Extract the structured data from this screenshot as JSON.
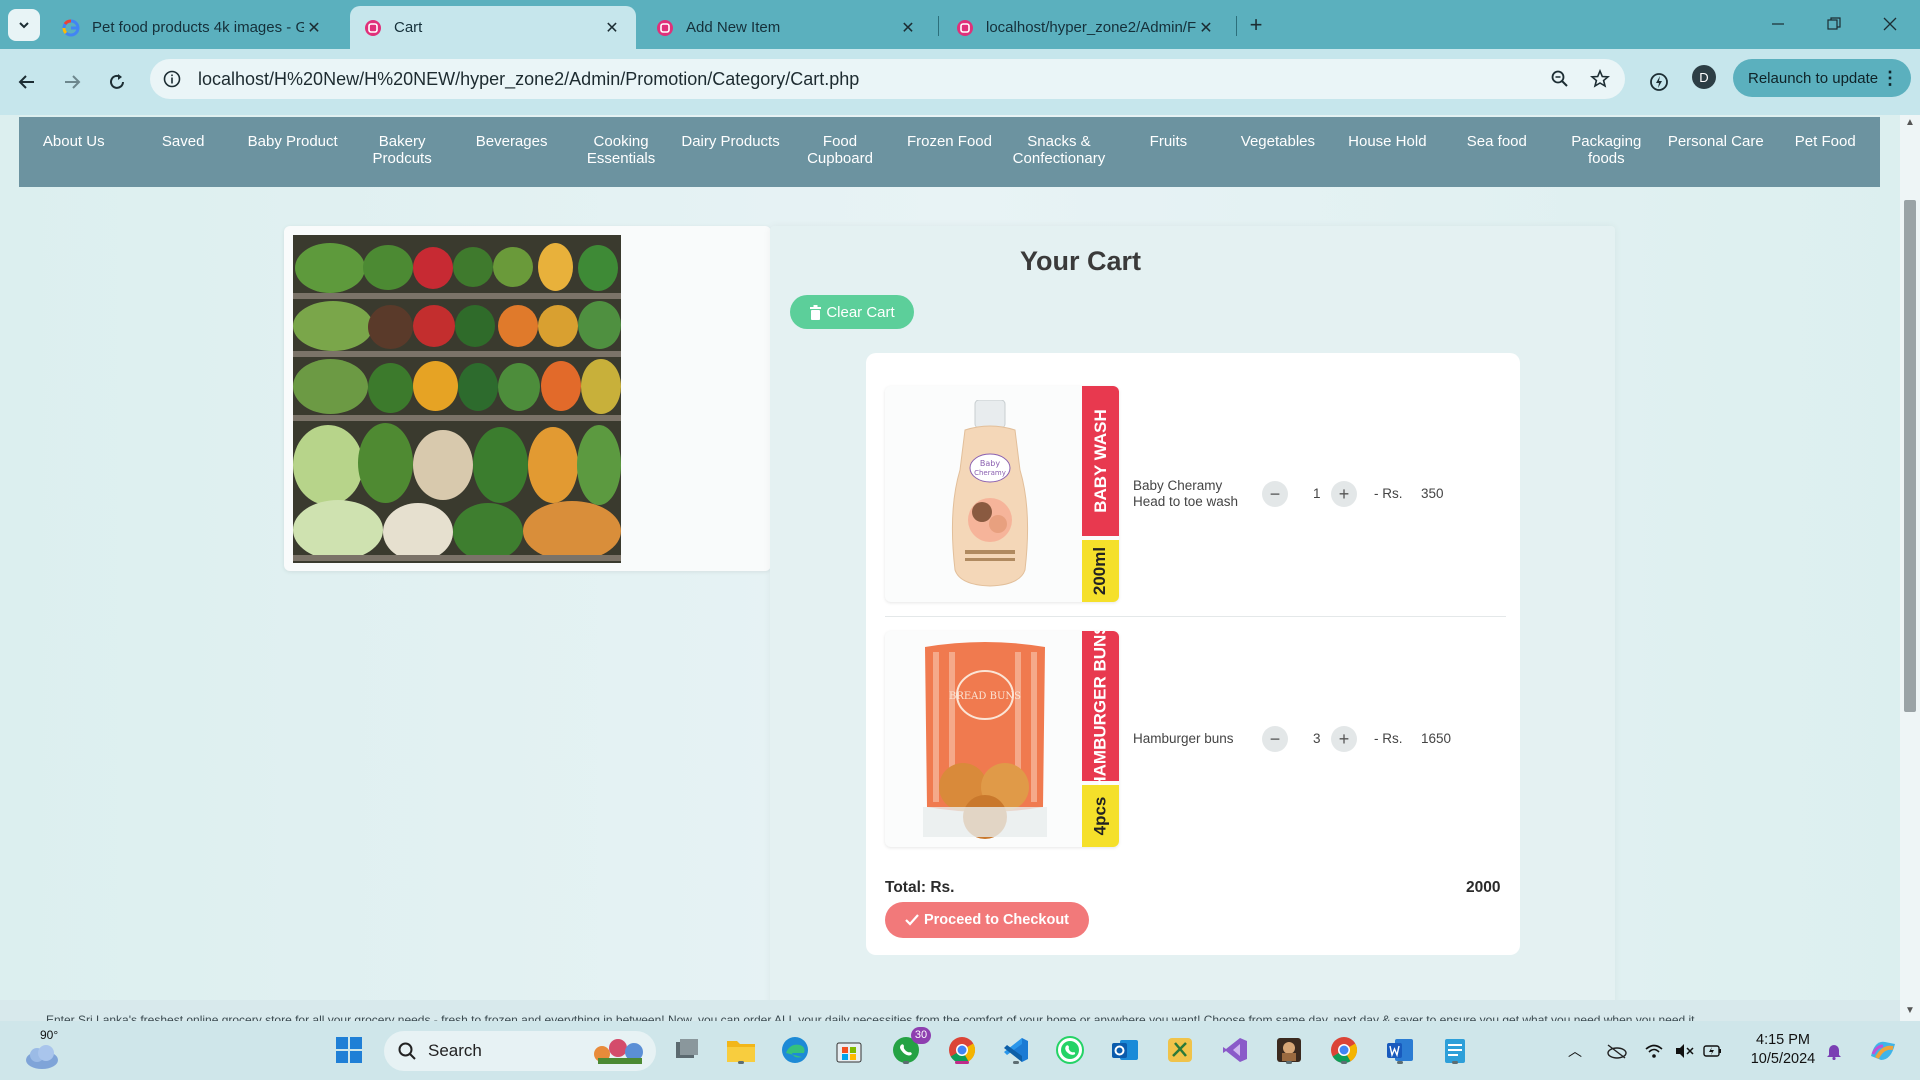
{
  "browser": {
    "tabs": [
      {
        "title": "Pet food products 4k images - G",
        "favicon": "google-icon",
        "active": false
      },
      {
        "title": "Cart",
        "favicon": "php-app-icon",
        "active": true
      },
      {
        "title": "Add New Item",
        "favicon": "php-app-icon",
        "active": false
      },
      {
        "title": "localhost/hyper_zone2/Admin/F",
        "favicon": "php-app-icon",
        "active": false
      }
    ],
    "url": "localhost/H%20New/H%20NEW/hyper_zone2/Admin/Promotion/Category/Cart.php",
    "profile_initial": "D",
    "relaunch_label": "Relaunch to update"
  },
  "categories": [
    "About Us",
    "Saved",
    "Baby Product",
    "Bakery Prodcuts",
    "Beverages",
    "Cooking Essentials",
    "Dairy Products",
    "Food Cupboard",
    "Frozen Food",
    "Snacks & Confectionary",
    "Fruits",
    "Vegetables",
    "House Hold",
    "Sea food",
    "Packaging foods",
    "Personal Care",
    "Pet Food"
  ],
  "cart": {
    "title": "Your Cart",
    "clear_label": "Clear Cart",
    "items": [
      {
        "name": "Baby Cheramy Head to toe wash",
        "ribbon": "BABY WASH",
        "size": "200ml",
        "qty": "1",
        "rs_label": "- Rs.",
        "price": "350"
      },
      {
        "name": "Hamburger buns",
        "ribbon": "HAMBURGER BUNS",
        "size": "4pcs",
        "qty": "3",
        "rs_label": "- Rs.",
        "price": "1650"
      }
    ],
    "total_label": "Total: Rs.",
    "total_value": "2000",
    "checkout_label": "Proceed to Checkout"
  },
  "footer": {
    "text": "Enter Sri Lanka's freshest online grocery store for all your grocery needs - fresh to frozen and everything in between! Now, you can order ALL your daily necessities from the comfort of your home or anywhere you want! Choose from same day, next day & saver to ensure you get what you need when you need it."
  },
  "taskbar": {
    "weather_temp": "90°",
    "search_label": "Search",
    "whatsapp_badge": "30",
    "time": "4:15 PM",
    "date": "10/5/2024"
  },
  "colors": {
    "chrome": "#5bb0be",
    "toolbar": "#c6e6ec",
    "catnav": "#6c93a0",
    "clear_button": "#5ccf9a",
    "checkout_button": "#f2797a",
    "ribbon_red": "#e8394f",
    "ribbon_yellow": "#f5e02a"
  }
}
